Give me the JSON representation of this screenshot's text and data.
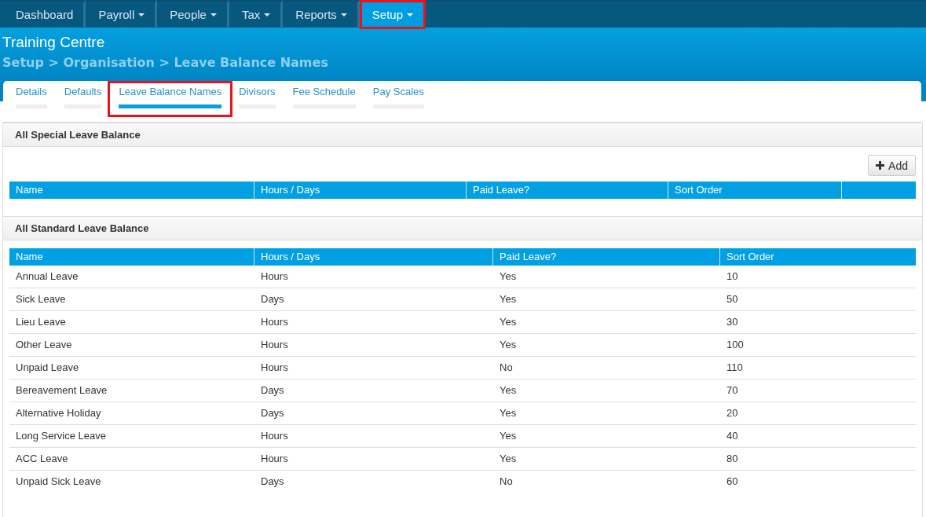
{
  "nav": [
    {
      "label": "Dashboard",
      "dropdown": false,
      "selected": false,
      "highlighted": false
    },
    {
      "label": "Payroll",
      "dropdown": true,
      "selected": false,
      "highlighted": false
    },
    {
      "label": "People",
      "dropdown": true,
      "selected": false,
      "highlighted": false
    },
    {
      "label": "Tax",
      "dropdown": true,
      "selected": false,
      "highlighted": false
    },
    {
      "label": "Reports",
      "dropdown": true,
      "selected": false,
      "highlighted": false
    },
    {
      "label": "Setup",
      "dropdown": true,
      "selected": true,
      "highlighted": true
    }
  ],
  "header": {
    "title": "Training Centre",
    "breadcrumb": "Setup > Organisation > Leave Balance Names"
  },
  "tabs": [
    {
      "label": "Details",
      "selected": false,
      "highlighted": false
    },
    {
      "label": "Defaults",
      "selected": false,
      "highlighted": false
    },
    {
      "label": "Leave Balance Names",
      "selected": true,
      "highlighted": true
    },
    {
      "label": "Divisors",
      "selected": false,
      "highlighted": false
    },
    {
      "label": "Fee Schedule",
      "selected": false,
      "highlighted": false
    },
    {
      "label": "Pay Scales",
      "selected": false,
      "highlighted": false
    }
  ],
  "special": {
    "title": "All Special Leave Balance",
    "add_button": "Add",
    "columns": [
      "Name",
      "Hours / Days",
      "Paid Leave?",
      "Sort Order",
      ""
    ]
  },
  "standard": {
    "title": "All Standard Leave Balance",
    "columns": [
      "Name",
      "Hours / Days",
      "Paid Leave?",
      "Sort Order"
    ],
    "rows": [
      [
        "Annual Leave",
        "Hours",
        "Yes",
        "10"
      ],
      [
        "Sick Leave",
        "Days",
        "Yes",
        "50"
      ],
      [
        "Lieu Leave",
        "Hours",
        "Yes",
        "30"
      ],
      [
        "Other Leave",
        "Hours",
        "Yes",
        "100"
      ],
      [
        "Unpaid Leave",
        "Hours",
        "No",
        "110"
      ],
      [
        "Bereavement Leave",
        "Days",
        "Yes",
        "70"
      ],
      [
        "Alternative Holiday",
        "Days",
        "Yes",
        "20"
      ],
      [
        "Long Service Leave",
        "Hours",
        "Yes",
        "40"
      ],
      [
        "ACC Leave",
        "Hours",
        "Yes",
        "80"
      ],
      [
        "Unpaid Sick Leave",
        "Days",
        "No",
        "60"
      ]
    ]
  }
}
